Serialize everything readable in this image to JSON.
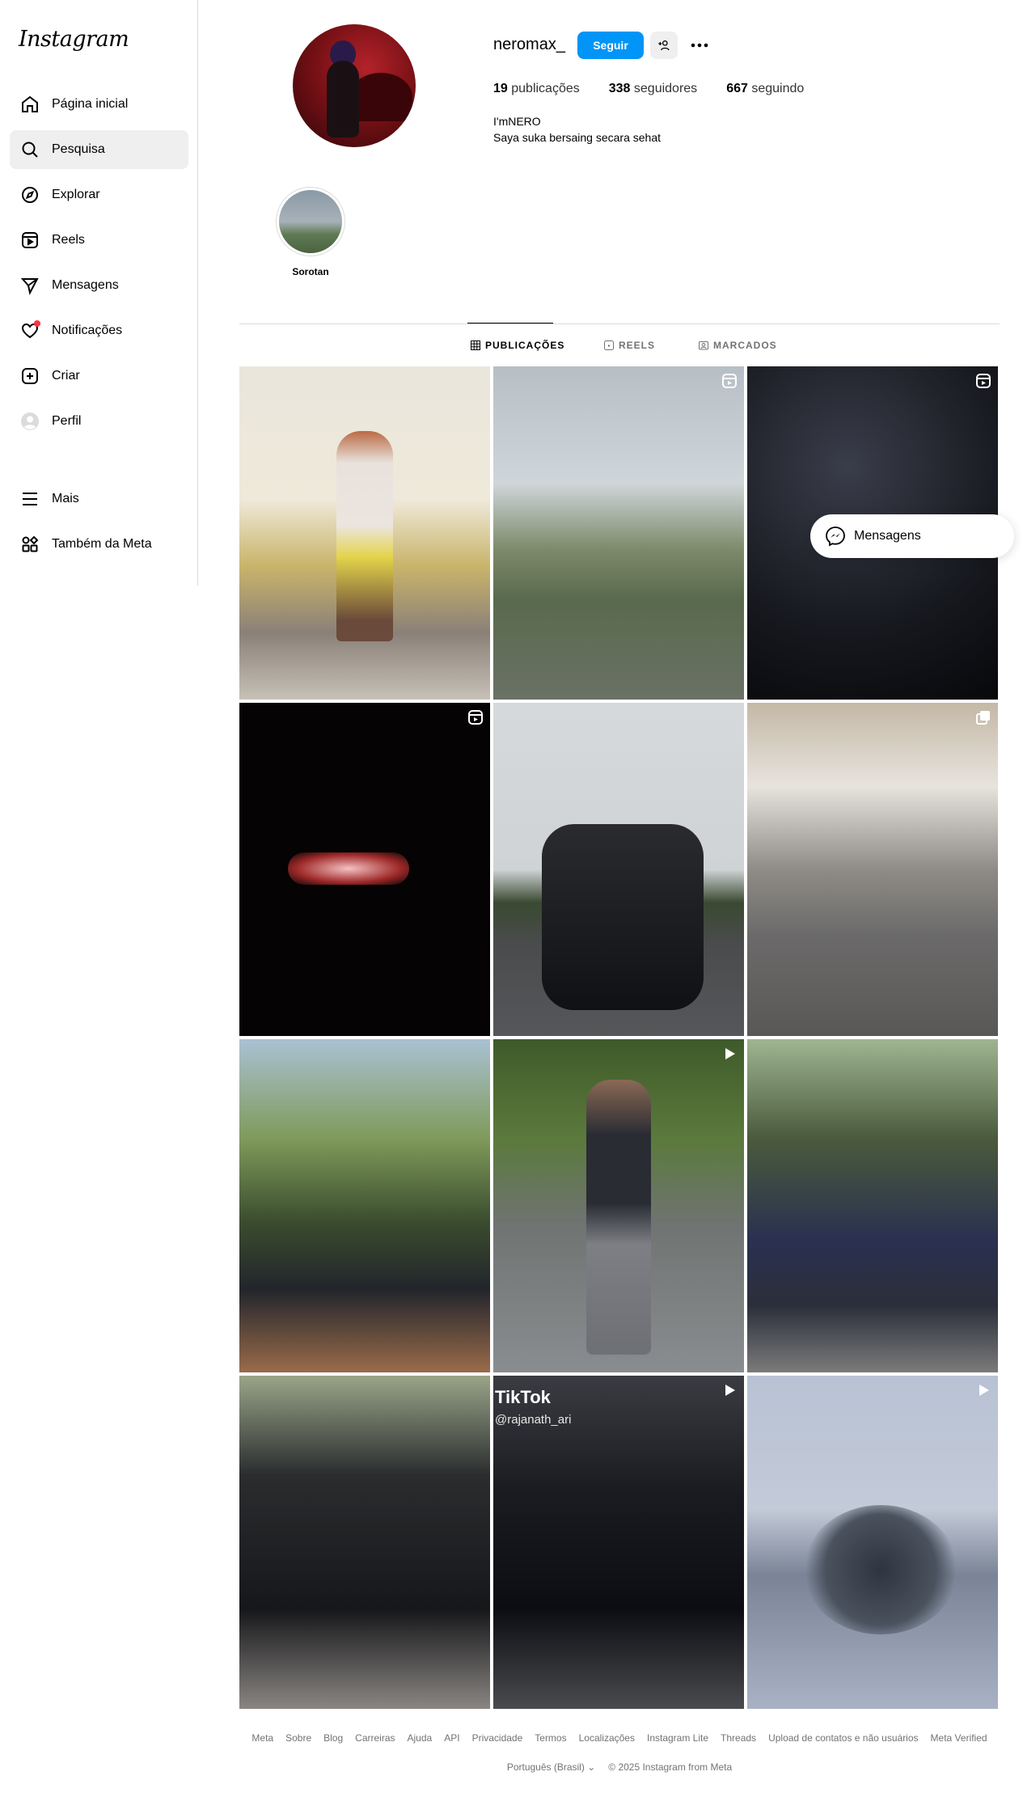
{
  "sidebar": {
    "logo": "Instagram",
    "items": [
      {
        "label": "Página inicial",
        "icon": "home-icon"
      },
      {
        "label": "Pesquisa",
        "icon": "search-icon"
      },
      {
        "label": "Explorar",
        "icon": "compass-icon"
      },
      {
        "label": "Reels",
        "icon": "reels-icon"
      },
      {
        "label": "Mensagens",
        "icon": "paper-plane-icon"
      },
      {
        "label": "Notificações",
        "icon": "heart-icon"
      },
      {
        "label": "Criar",
        "icon": "plus-square-icon"
      },
      {
        "label": "Perfil",
        "icon": "avatar-icon"
      },
      {
        "label": "Mais",
        "icon": "hamburger-icon"
      },
      {
        "label": "Também da Meta",
        "icon": "meta-apps-icon"
      }
    ],
    "active_item": "Pesquisa"
  },
  "profile": {
    "username": "neromax_",
    "follow_label": "Seguir",
    "stats": {
      "posts": {
        "count": "19",
        "label": "publicações"
      },
      "followers": {
        "count": "338",
        "label": "seguidores"
      },
      "following": {
        "count": "667",
        "label": "seguindo"
      }
    },
    "full_name": "I'mNERO",
    "bio": "Saya suka bersaing secara sehat"
  },
  "highlights": [
    {
      "label": "Sorotan"
    }
  ],
  "tabs": [
    {
      "label": "PUBLICAÇÕES",
      "icon": "grid-icon",
      "active": true
    },
    {
      "label": "REELS",
      "icon": "reels-icon",
      "active": false
    },
    {
      "label": "MARCADOS",
      "icon": "tagged-icon",
      "active": false
    }
  ],
  "posts": [
    {
      "type": "photo"
    },
    {
      "type": "reel"
    },
    {
      "type": "reel"
    },
    {
      "type": "reel"
    },
    {
      "type": "photo"
    },
    {
      "type": "carousel"
    },
    {
      "type": "photo"
    },
    {
      "type": "video"
    },
    {
      "type": "photo"
    },
    {
      "type": "photo"
    },
    {
      "type": "video",
      "overlay_title": "TikTok",
      "overlay_user": "@rajanath_ari"
    },
    {
      "type": "video"
    }
  ],
  "floating_messages": {
    "label": "Mensagens",
    "icon": "messenger-icon"
  },
  "footer": {
    "links": [
      "Meta",
      "Sobre",
      "Blog",
      "Carreiras",
      "Ajuda",
      "API",
      "Privacidade",
      "Termos",
      "Localizações",
      "Instagram Lite",
      "Threads",
      "Upload de contatos e não usuários",
      "Meta Verified"
    ],
    "language": "Português (Brasil)",
    "copyright": "© 2025 Instagram from Meta"
  },
  "colors": {
    "accent": "#0095f6",
    "notification_dot": "#ff3040",
    "muted_text": "#737373",
    "active_nav_bg": "#efefef"
  }
}
